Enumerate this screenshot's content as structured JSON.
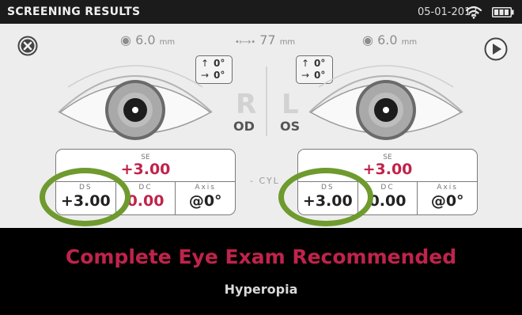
{
  "status_bar": {
    "title": "SCREENING RESULTS",
    "date": "05-01-2013",
    "icons": [
      "wifi-icon",
      "battery-icon"
    ]
  },
  "controls": {
    "close_icon": "close-icon",
    "next_icon": "play-icon"
  },
  "measurements": {
    "pupil_left": {
      "value": "6.0",
      "unit": "mm"
    },
    "pupil_distance": {
      "value": "77",
      "unit": "mm"
    },
    "pupil_right": {
      "value": "6.0",
      "unit": "mm"
    }
  },
  "gaze": {
    "right_eye": {
      "vertical": "0°",
      "horizontal": "0°"
    },
    "left_eye": {
      "vertical": "0°",
      "horizontal": "0°"
    }
  },
  "eye_labels": {
    "right_letter": "R",
    "left_letter": "L",
    "right_code": "OD",
    "left_code": "OS"
  },
  "cyl_mode": "- CYL",
  "prescription": {
    "right": {
      "se_label": "SE",
      "se_value": "+3.00",
      "ds_label": "DS",
      "ds_value": "+3.00",
      "dc_label": "DC",
      "dc_value": "0.00",
      "axis_label": "Axis",
      "axis_value": "@0°"
    },
    "left": {
      "se_label": "SE",
      "se_value": "+3.00",
      "ds_label": "DS",
      "ds_value": "+3.00",
      "dc_label": "DC",
      "dc_value": "0.00",
      "axis_label": "Axis",
      "axis_value": "@0°"
    }
  },
  "result": {
    "recommendation": "Complete Eye Exam Recommended",
    "diagnosis": "Hyperopia"
  },
  "colors": {
    "accent_red": "#c0234b",
    "highlight_green": "#6f9a2e",
    "panel": "#ededed",
    "background": "#000000"
  }
}
